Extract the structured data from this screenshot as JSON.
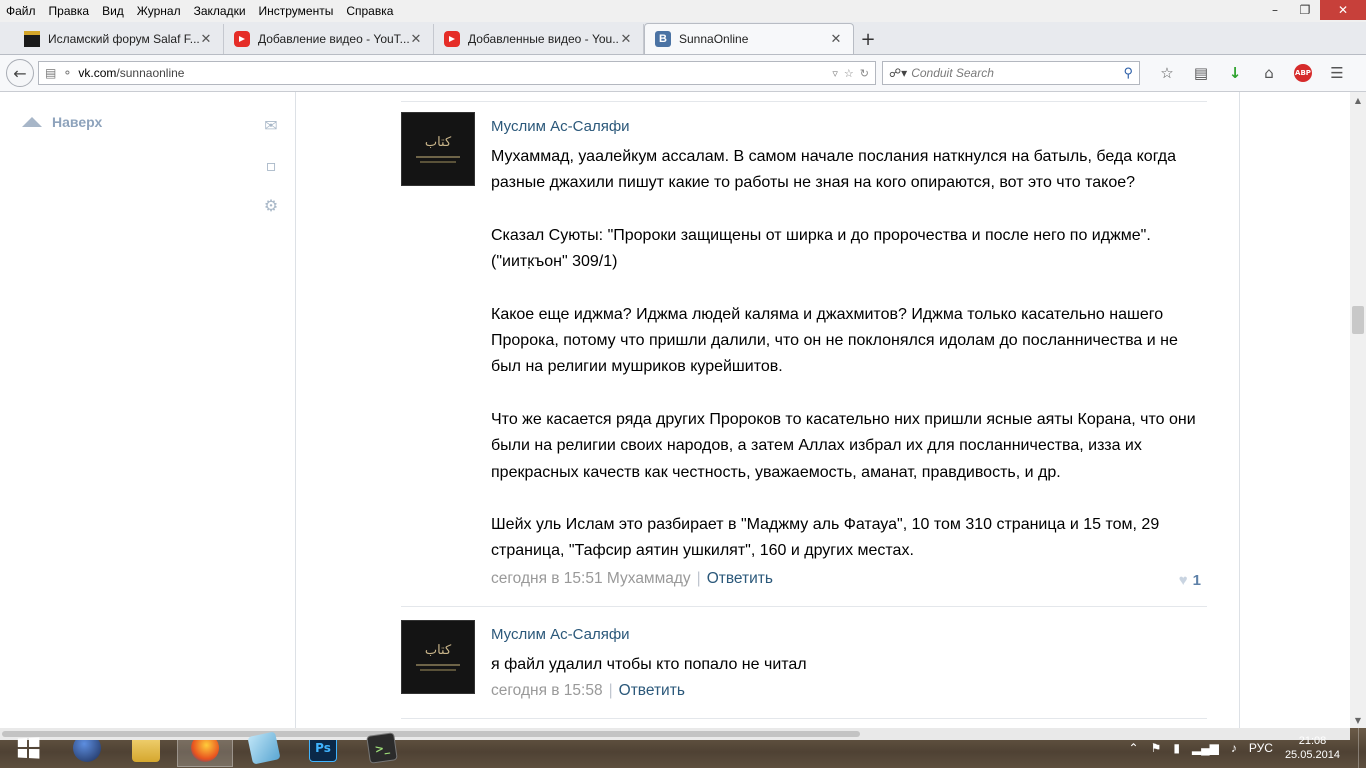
{
  "menu": [
    "Файл",
    "Правка",
    "Вид",
    "Журнал",
    "Закладки",
    "Инструменты",
    "Справка"
  ],
  "window_controls": {
    "minimize": "–",
    "restore": "❐",
    "close": "✕"
  },
  "tabs": [
    {
      "title": "Исламский форум Salaf F...",
      "favicon": "kaaba-icon"
    },
    {
      "title": "Добавление видео - YouT...",
      "favicon": "youtube-icon"
    },
    {
      "title": "Добавленные видео - You...",
      "favicon": "youtube-icon"
    },
    {
      "title": "SunnaOnline",
      "favicon": "vk-icon",
      "active": true
    }
  ],
  "tab_close": "✕",
  "new_tab": "+",
  "vk_letter": "B",
  "address": {
    "domain": "vk.com",
    "path": "/sunnaonline"
  },
  "search": {
    "placeholder": "Conduit Search"
  },
  "sidebar": {
    "up_label": "Наверх"
  },
  "comments": [
    {
      "author": "Муслим Ас-Саляфи",
      "text": "Мухаммад, уаалейкум ассалам. В самом начале послания наткнулся на батыль, беда когда разные джахили пишут какие то работы не зная на кого опираются, вот это что такое?\n\nСказал Суюты: \"Пророки защищены от ширка и до пророчества и после него по иджме\".\n(\"иитк̣ъон\" 309/1)\n\nКакое еще иджма? Иджма людей каляма и джахмитов? Иджма только касательно нашего Пророка, потому что пришли далили, что он не поклонялся идолам до посланничества и не был на религии мушриков курейшитов.\n\nЧто же касается ряда других Пророков то касательно них пришли ясные аяты Корана, что они были на религии своих народов, а затем Аллах избрал их для посланничества, изза их прекрасных качеств как честность, уважаемость, аманат, правдивость, и др.\n\nШейх уль Ислам это разбирает в \"Маджму аль Фатауа\", 10 том 310 страница и 15 том, 29 страница, \"Тафсир аятин ушкилят\", 160 и других местах.",
      "time": "сегодня в 15:51 Мухаммаду",
      "reply": "Ответить",
      "likes": "1"
    },
    {
      "author": "Муслим Ас-Саляфи",
      "text": "я файл удалил чтобы кто попало не читал",
      "time": "сегодня в 15:58",
      "reply": "Ответить"
    }
  ],
  "avatar_text": "كتاب",
  "taskbar": {
    "apps": [
      "windows-start",
      "globe",
      "file-explorer",
      "firefox",
      "notepad",
      "photoshop",
      "terminal"
    ],
    "ps_label": "Ps",
    "cmd_label": ">_"
  },
  "tray": {
    "icons": [
      "chevron-up-icon",
      "flag-icon",
      "battery-icon",
      "signal-icon",
      "volume-icon"
    ],
    "lang": "РУС",
    "time": "21:08",
    "date": "25.05.2014"
  }
}
